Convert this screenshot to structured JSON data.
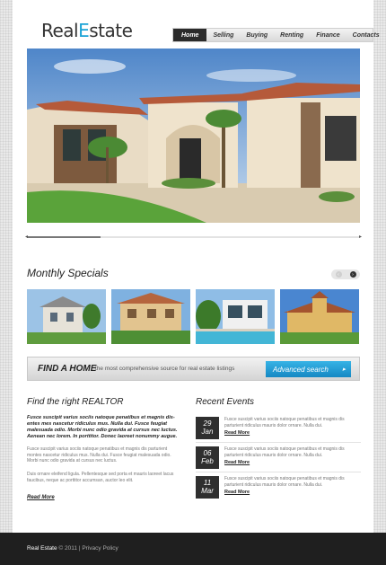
{
  "logo": {
    "part1": "Real",
    "part2": "E",
    "part3": "state"
  },
  "nav": [
    "Home",
    "Selling",
    "Buying",
    "Renting",
    "Finance",
    "Contacts"
  ],
  "monthly_specials": {
    "title": "Monthly Specials"
  },
  "find_home": {
    "title": "FIND A HOME",
    "description": "the most comprehensive source for real estate listings",
    "button": "Advanced search"
  },
  "realtor": {
    "title": "Find the right REALTOR",
    "intro": "Fusce suscipit varius sociis natoque penatibus et magnis dis-entes mes nascetur ridiculus mus. Nulla dui. Fusce feugiat malesuada odio. Morbi nunc odio gravida at cursus nec luctus. Aenean nec lorem. In porttitor. Donec laoreet nonummy augue.",
    "p1": "Fusce suscipit varius sociis natoque penatibus et magnis dis parturient montes nascetur ridiculus mus. Nulla dui. Fusce feugiat malesuada odio. Morbi nunc odio gravida at cursus nec luctus.",
    "p2": "Duis ornare eleifend ligula. Pellentesque sed porta et mauris laoreet lacus faucibus, neque ac porttitor accumsan, auctor leo elit.",
    "read_more": "Read More"
  },
  "events": {
    "title": "Recent Events",
    "items": [
      {
        "day": "29",
        "month": "Jan",
        "text": "Fusce suscipit varius sociis natoque penatibus et magnis dis parturient ridiculus mauris dolor ornare. Nulla dui.",
        "more": "Read More"
      },
      {
        "day": "06",
        "month": "Feb",
        "text": "Fusce suscipit varius sociis natoque penatibus et magnis dis parturient ridiculus mauris dolor ornare. Nulla dui.",
        "more": "Read More"
      },
      {
        "day": "11",
        "month": "Mar",
        "text": "Fusce suscipit varius sociis natoque penatibus et magnis dis parturient ridiculus mauris dolor ornare. Nulla dui.",
        "more": "Read More"
      }
    ]
  },
  "footer": {
    "brand": "Real Estate",
    "copyright": "© 2011",
    "separator": "|",
    "privacy": "Privacy Policy"
  },
  "colors": {
    "accent": "#1aa3d6",
    "dark": "#1f1f1f"
  }
}
